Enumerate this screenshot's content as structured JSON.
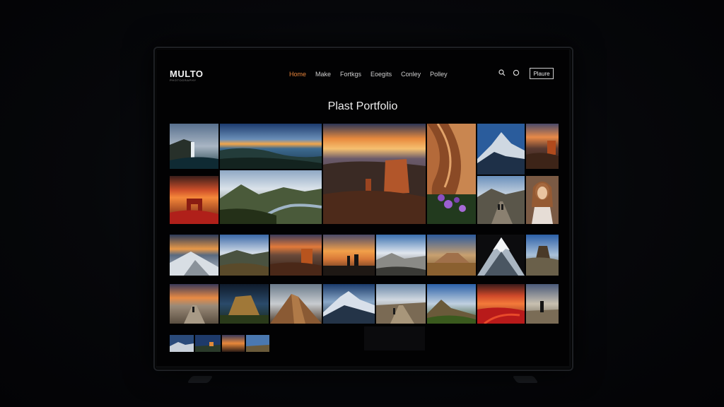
{
  "nav": {
    "logo": "MULTO",
    "logo_sub": "PHOTOGRAPHY",
    "items": [
      {
        "label": "Home",
        "active": true
      },
      {
        "label": "Make",
        "active": false
      },
      {
        "label": "Fortkgs",
        "active": false
      },
      {
        "label": "Eoegits",
        "active": false
      },
      {
        "label": "Conley",
        "active": false
      },
      {
        "label": "Polley",
        "active": false
      }
    ],
    "icons": [
      "search-icon",
      "chat-icon"
    ],
    "button_label": "Plaure"
  },
  "page": {
    "title": "Plast Portfolio"
  },
  "colors": {
    "accent": "#e8843a",
    "text": "#ececec",
    "background": "#020203"
  }
}
